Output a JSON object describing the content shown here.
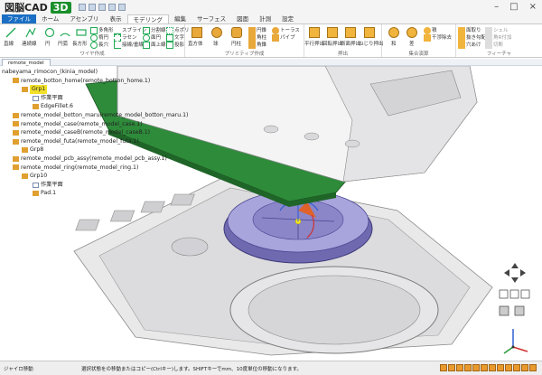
{
  "app": {
    "logo": "図脳CAD",
    "logo_3d": "3D"
  },
  "tabs": [
    {
      "label": "ファイル"
    },
    {
      "label": "ホーム"
    },
    {
      "label": "アセンブリ"
    },
    {
      "label": "表示"
    },
    {
      "label": "モデリング"
    },
    {
      "label": "編集"
    },
    {
      "label": "サーフェス"
    },
    {
      "label": "図面"
    },
    {
      "label": "計測"
    },
    {
      "label": "設定"
    }
  ],
  "active_tab": "モデリング",
  "ribbon": {
    "wire": {
      "label": "ワイヤ作成",
      "big": [
        "直線",
        "連続線",
        "円",
        "円弧",
        "長方形"
      ],
      "small": [
        "多角形",
        "楕円",
        "長穴",
        "スプライン",
        "ラセン",
        "接線/垂線",
        "分割線",
        "面円",
        "面上線",
        "点ポリ",
        "文字",
        "投影"
      ]
    },
    "primitive": {
      "label": "プリミティブ作成",
      "big": [
        "直方体",
        "球",
        "円柱"
      ],
      "small": [
        "円錐",
        "角柱",
        "角錐",
        "トーラス",
        "パイプ"
      ]
    },
    "sketch": {
      "label": "押出",
      "big": [
        "平行押出",
        "回転押出",
        "断面押出",
        "ねじり押出"
      ]
    },
    "boolean": {
      "label": "集合演算",
      "big": [
        "和",
        "差"
      ],
      "small": [
        "積",
        "干渉除去"
      ]
    },
    "feature": {
      "label": "フィーチャ",
      "small": [
        "面取り",
        "抜き勾配",
        "穴あけ",
        "シェル",
        "角R付加",
        "切断"
      ]
    }
  },
  "document_tab": "remote_model",
  "tree": [
    {
      "label": "nabeyama_rimocon_(kinia_model)",
      "level": 0
    },
    {
      "label": "remote_botton_home(remote_botton_home.1)",
      "level": 1
    },
    {
      "label": "Grp1",
      "level": 2,
      "selected": true
    },
    {
      "label": "作業平面",
      "level": 3
    },
    {
      "label": "EdgeFillet.6",
      "level": 3
    },
    {
      "label": "remote_model_botton_maru(remote_model_botton_maru.1)",
      "level": 1
    },
    {
      "label": "remote_model_case(remote_model_case.1)",
      "level": 1
    },
    {
      "label": "remote_model_caseB(remote_model_caseB.1)",
      "level": 1
    },
    {
      "label": "remote_model_futa(remote_model_futa.1)",
      "level": 1
    },
    {
      "label": "Grp8",
      "level": 2
    },
    {
      "label": "remote_model_pcb_assy(remote_model_pcb_assy.1)",
      "level": 1
    },
    {
      "label": "remote_model_ring(remote_model_ring.1)",
      "level": 1
    },
    {
      "label": "Grp10",
      "level": 2
    },
    {
      "label": "作業平面",
      "level": 3
    },
    {
      "label": "Pad.1",
      "level": 3
    }
  ],
  "status": {
    "mode": "ジャイロ移動",
    "message": "選択状態をの移動またはコピー(Ctrlキー)します。SHIFTキーでmm、10度単位の移動になります。"
  },
  "colors": {
    "file_tab": "#1a6fc4",
    "pcb": "#2e8b3a",
    "ring": "#8a86c8",
    "selected": "#f2e12b"
  }
}
